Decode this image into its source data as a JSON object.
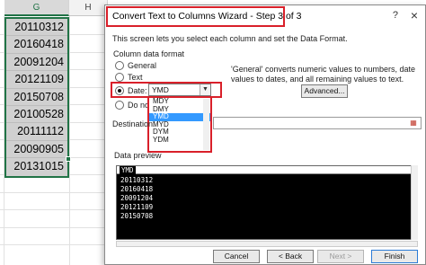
{
  "sheet": {
    "columns": [
      "G",
      "H"
    ],
    "values": [
      "20110312",
      "20160418",
      "20091204",
      "20121109",
      "20150708",
      "20100528",
      "20111112",
      "20090905",
      "20131015"
    ]
  },
  "dialog": {
    "title": "Convert Text to Columns Wizard - Step 3 of 3",
    "help": "?",
    "close": "×",
    "intro": "This screen lets you select each column and set the Data Format.",
    "group_title": "Column data format",
    "radios": {
      "general": "General",
      "text": "Text",
      "date": "Date:",
      "skip": "Do not"
    },
    "date_format": {
      "value": "YMD",
      "options": [
        "MDY",
        "DMY",
        "YMD",
        "MYD",
        "DYM",
        "YDM"
      ],
      "selected": "YMD"
    },
    "description": "'General' converts numeric values to numbers, date values to dates, and all remaining values to text.",
    "advanced_label": "Advanced...",
    "destination_label": "Destination:",
    "destination_value": "",
    "preview_label": "Data preview",
    "preview_header": "YMD",
    "preview_rows": [
      "20110312",
      "20160418",
      "20091204",
      "20121109",
      "20150708"
    ],
    "buttons": {
      "cancel": "Cancel",
      "back": "< Back",
      "next": "Next >",
      "finish": "Finish"
    }
  },
  "colors": {
    "highlight": "#d9202a",
    "excel_green": "#217346",
    "selection": "#3399ff"
  }
}
